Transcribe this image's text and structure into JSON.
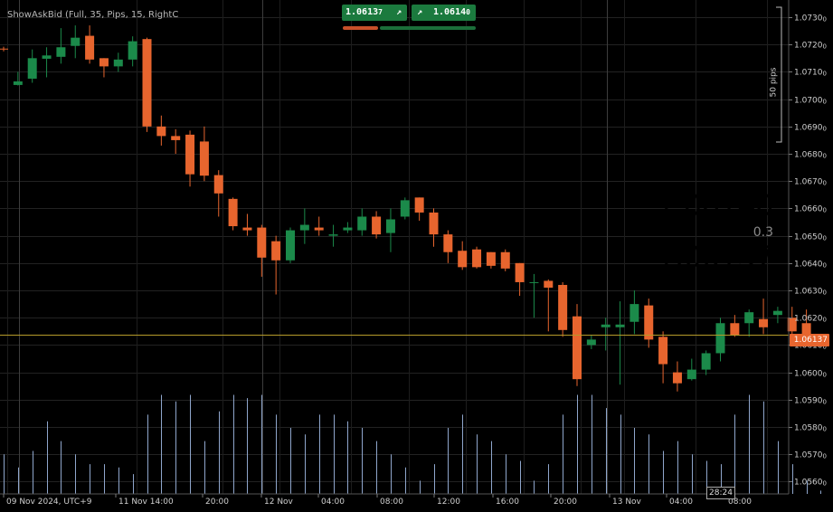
{
  "indicator_title": "ShowAskBid (Full, 35, Pips, 15, RightC",
  "quotes": {
    "bid": {
      "main": "1.0613",
      "sub": "7",
      "arrow": "↗"
    },
    "ask": {
      "main": "1.0614",
      "sub": "0",
      "arrow": "↗"
    }
  },
  "big": {
    "ask": "1.06140",
    "spread": "0.3",
    "bid": "1.06137"
  },
  "pips_label": "50 pips",
  "current_price_tag": "1.06137",
  "timer": "28:24",
  "colors": {
    "bull": "#1b8a4a",
    "bear": "#e7652e",
    "volume": "#8fa6cc",
    "ask": "#1f9a3a",
    "bid": "#a01818",
    "price_line": "#b59a2a"
  },
  "chart_data": {
    "type": "candlestick",
    "yticks": [
      "1.0730",
      "1.0720",
      "1.0710",
      "1.0700",
      "1.0690",
      "1.0680",
      "1.0670",
      "1.0660",
      "1.0650",
      "1.0640",
      "1.0630",
      "1.0620",
      "1.0610",
      "1.0600",
      "1.0590",
      "1.0580",
      "1.0570",
      "1.0560"
    ],
    "ytick_sub": "0",
    "ylim": [
      1.05555,
      1.07363
    ],
    "xlabels": [
      "09 Nov 2024, UTC+9",
      "11 Nov 14:00",
      "20:00",
      "12 Nov",
      "04:00",
      "08:00",
      "12:00",
      "16:00",
      "20:00",
      "13 Nov",
      "04:00",
      "08:00"
    ],
    "current_price": 1.06137,
    "candles": [
      [
        1.07185,
        1.07182,
        1.07192,
        1.07175
      ],
      [
        1.07052,
        1.07065,
        1.071,
        1.0705
      ],
      [
        1.07075,
        1.0715,
        1.07182,
        1.0706
      ],
      [
        1.07148,
        1.0716,
        1.0719,
        1.0708
      ],
      [
        1.07155,
        1.0719,
        1.0726,
        1.0713
      ],
      [
        1.07195,
        1.07225,
        1.0727,
        1.0715
      ],
      [
        1.07232,
        1.07145,
        1.0727,
        1.0713
      ],
      [
        1.0715,
        1.0712,
        1.0715,
        1.0708
      ],
      [
        1.0712,
        1.07145,
        1.0717,
        1.071
      ],
      [
        1.07145,
        1.07212,
        1.0723,
        1.0712
      ],
      [
        1.0722,
        1.069,
        1.07225,
        1.0688
      ],
      [
        1.069,
        1.06865,
        1.0694,
        1.0683
      ],
      [
        1.06865,
        1.0685,
        1.0689,
        1.068
      ],
      [
        1.0687,
        1.06725,
        1.06885,
        1.0668
      ],
      [
        1.06845,
        1.0672,
        1.069,
        1.067
      ],
      [
        1.06722,
        1.06655,
        1.0674,
        1.0657
      ],
      [
        1.06635,
        1.06535,
        1.0664,
        1.0652
      ],
      [
        1.0653,
        1.0652,
        1.0658,
        1.065
      ],
      [
        1.0653,
        1.0642,
        1.0654,
        1.0635
      ],
      [
        1.0648,
        1.0641,
        1.065,
        1.06285
      ],
      [
        1.0641,
        1.0652,
        1.0653,
        1.064
      ],
      [
        1.0652,
        1.0654,
        1.066,
        1.0647
      ],
      [
        1.0653,
        1.0652,
        1.0657,
        1.065
      ],
      [
        1.065,
        1.06505,
        1.0654,
        1.0646
      ],
      [
        1.0652,
        1.0653,
        1.0655,
        1.0651
      ],
      [
        1.0652,
        1.0657,
        1.066,
        1.065
      ],
      [
        1.0657,
        1.06505,
        1.0659,
        1.0649
      ],
      [
        1.0651,
        1.0656,
        1.066,
        1.0644
      ],
      [
        1.0657,
        1.0663,
        1.0664,
        1.0656
      ],
      [
        1.0664,
        1.06585,
        1.0664,
        1.06555
      ],
      [
        1.06585,
        1.06505,
        1.066,
        1.0646
      ],
      [
        1.06505,
        1.0644,
        1.0652,
        1.064
      ],
      [
        1.06445,
        1.06385,
        1.0648,
        1.06375
      ],
      [
        1.0645,
        1.06385,
        1.0646,
        1.0638
      ],
      [
        1.0644,
        1.0639,
        1.0644,
        1.0638
      ],
      [
        1.0644,
        1.0638,
        1.0645,
        1.0637
      ],
      [
        1.064,
        1.0633,
        1.064,
        1.0628
      ],
      [
        1.0633,
        1.0633,
        1.0636,
        1.062
      ],
      [
        1.06335,
        1.0631,
        1.0634,
        1.0615
      ],
      [
        1.0632,
        1.06155,
        1.0633,
        1.0613
      ],
      [
        1.06205,
        1.05975,
        1.0625,
        1.0595
      ],
      [
        1.061,
        1.0612,
        1.06135,
        1.06085
      ],
      [
        1.06165,
        1.06175,
        1.062,
        1.0608
      ],
      [
        1.06165,
        1.06175,
        1.0626,
        1.05955
      ],
      [
        1.06185,
        1.0625,
        1.063,
        1.0614
      ],
      [
        1.06245,
        1.0612,
        1.0627,
        1.0609
      ],
      [
        1.0613,
        1.0603,
        1.0615,
        1.0596
      ],
      [
        1.06,
        1.0596,
        1.0604,
        1.0593
      ],
      [
        1.05975,
        1.0601,
        1.0605,
        1.0597
      ],
      [
        1.0601,
        1.0607,
        1.0608,
        1.0599
      ],
      [
        1.0607,
        1.0618,
        1.062,
        1.0604
      ],
      [
        1.0618,
        1.06135,
        1.0621,
        1.0613
      ],
      [
        1.0618,
        1.0622,
        1.0623,
        1.0613
      ],
      [
        1.06195,
        1.06165,
        1.0627,
        1.0614
      ],
      [
        1.0621,
        1.06225,
        1.0624,
        1.0618
      ],
      [
        1.062,
        1.0615,
        1.0624,
        1.0613
      ],
      [
        1.0618,
        1.06137,
        1.0623,
        1.06135
      ]
    ],
    "volume_heights": [
      60,
      40,
      65,
      110,
      80,
      60,
      45,
      45,
      40,
      30,
      120,
      150,
      140,
      150,
      80,
      125,
      150,
      145,
      150,
      120,
      100,
      90,
      120,
      120,
      110,
      100,
      80,
      60,
      40,
      20,
      45,
      100,
      120,
      90,
      80,
      60,
      50,
      20,
      45,
      120,
      150,
      150,
      130,
      120,
      100,
      90,
      65,
      80,
      60,
      50,
      45,
      120,
      150,
      140,
      80,
      45,
      20,
      5
    ]
  }
}
